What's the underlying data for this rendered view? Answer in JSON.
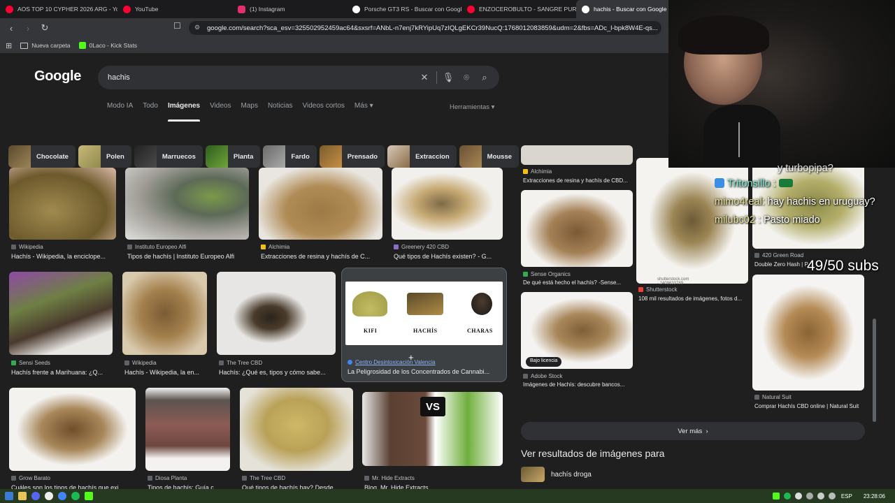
{
  "browser": {
    "tabs": [
      {
        "title": "AOS TOP 10 CYPHER 2026 ARG - You",
        "color": "#ff0033"
      },
      {
        "title": "YouTube",
        "color": "#ff0033"
      },
      {
        "title": "(1) Instagram",
        "color": "#e1306c"
      },
      {
        "title": "Porsche GT3 RS - Buscar con Google",
        "color": "#ffffff"
      },
      {
        "title": "ENZOCEROBULTO - SANGRE PURA D",
        "color": "#ff0033"
      },
      {
        "title": "hachis - Buscar con Google",
        "color": "#ffffff",
        "active": true
      }
    ],
    "url": "google.com/search?sca_esv=325502952459ac64&sxsrf=ANbL-n7enj7kRYipUq7zIQLgEKCr39NucQ:1768012083859&udm=2&fbs=ADc_l-bpk8W4E-qs...",
    "bookmarks": [
      {
        "label": "Nueva carpeta",
        "icon": "folder-icon"
      },
      {
        "label": "0Laco - Kick Stats",
        "icon": "kick-icon"
      }
    ]
  },
  "google": {
    "logo": "Google",
    "query": "hachis",
    "tabs": [
      "Modo IA",
      "Todo",
      "Imágenes",
      "Videos",
      "Maps",
      "Noticias",
      "Videos cortos",
      "Más"
    ],
    "active_tab": "Imágenes",
    "tools": "Herramientas"
  },
  "chips": [
    "Chocolate",
    "Polen",
    "Marruecos",
    "Planta",
    "Fardo",
    "Prensado",
    "Extraccion",
    "Mousse"
  ],
  "results": [
    {
      "source": "Wikipedia",
      "title": "Hachís - Wikipedia, la enciclope..."
    },
    {
      "source": "Instituto Europeo Alfi",
      "title": "Tipos de hachís | Instituto Europeo Alfi"
    },
    {
      "source": "Alchimia",
      "title": "Extracciones de resina y hachís de C..."
    },
    {
      "source": "Greenery 420 CBD",
      "title": "Qué tipos de Hachís existen? - G..."
    },
    {
      "source": "Alchimia",
      "title": "Extracciones de resina y hachís de CBD..."
    },
    {
      "source": "Sensi Seeds",
      "title": "Hachís frente a Marihuana: ¿Q..."
    },
    {
      "source": "Wikipedia",
      "title": "Hachís - Wikipedia, la en..."
    },
    {
      "source": "The Tree CBD",
      "title": "Hachís: ¿Qué es, tipos y cómo sabe..."
    },
    {
      "source": "Centro Desintoxicación Valencia",
      "title": "La Peligrosidad de los Concentrados de Cannabi..."
    },
    {
      "source": "Sense Organics",
      "title": "De qué está hecho el hachís? -Sense..."
    },
    {
      "source": "Shutterstock",
      "title": "108 mil resultados de imágenes, fotos d..."
    },
    {
      "source": "420 Green Road",
      "title": "Double Zero Hash | P..."
    },
    {
      "source": "Adobe Stock",
      "title": "Imágenes de Hachís: descubre bancos..."
    },
    {
      "source": "Natural Suit",
      "title": "Comprar Hachís CBD online | Natural Suit"
    },
    {
      "source": "Grow Barato",
      "title": "Cuáles son los tipos de hachís que exi..."
    },
    {
      "source": "Diosa Planta",
      "title": "Tipos de hachís: Guía c..."
    },
    {
      "source": "The Tree CBD",
      "title": "Qué tipos de hachís hay? Desde..."
    },
    {
      "source": "Mr. Hide Extracts",
      "title": "Blog, Mr. Hide Extracts"
    }
  ],
  "kifi_labels": [
    "KIFI",
    "HACHÍS",
    "CHARAS"
  ],
  "vs_badge": "VS",
  "license_badge": "Bajo licencia",
  "watermark": "shutterstock.com · 2409633789",
  "ver_mas": "Ver más",
  "ver_resultados": "Ver resultados de imágenes para",
  "related_query": "hachís droga",
  "overlay": {
    "chat": [
      {
        "user": "",
        "text": "y turbopipa?"
      },
      {
        "user": "Tritonsillo",
        "text": ""
      },
      {
        "user": "mimo4real",
        "text": ": hay hachis en uruguay?"
      },
      {
        "user": "milubc02",
        "text": ": Pasto miado"
      }
    ],
    "subs": "49/50 subs"
  },
  "taskbar": {
    "lang": "ESP",
    "time": "23:28:06"
  }
}
